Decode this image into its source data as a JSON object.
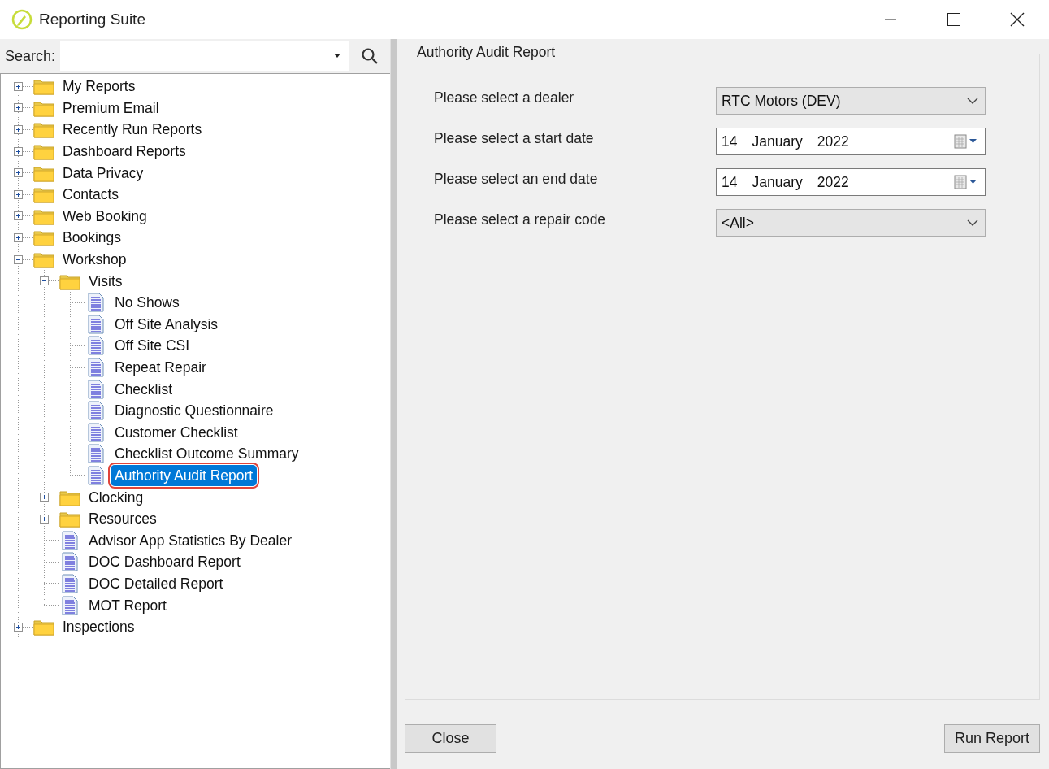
{
  "window": {
    "title": "Reporting Suite"
  },
  "search": {
    "label": "Search:"
  },
  "tree": [
    {
      "label": "My Reports",
      "kind": "folder",
      "expanded": false,
      "selected": false
    },
    {
      "label": "Premium Email",
      "kind": "folder",
      "expanded": false,
      "selected": false
    },
    {
      "label": "Recently Run Reports",
      "kind": "folder",
      "expanded": false,
      "selected": false
    },
    {
      "label": "Dashboard Reports",
      "kind": "folder",
      "expanded": false,
      "selected": false
    },
    {
      "label": "Data Privacy",
      "kind": "folder",
      "expanded": false,
      "selected": false
    },
    {
      "label": "Contacts",
      "kind": "folder",
      "expanded": false,
      "selected": false
    },
    {
      "label": "Web Booking",
      "kind": "folder",
      "expanded": false,
      "selected": false
    },
    {
      "label": "Bookings",
      "kind": "folder",
      "expanded": false,
      "selected": false
    },
    {
      "label": "Workshop",
      "kind": "folder",
      "expanded": true,
      "selected": false,
      "children": [
        {
          "label": "Visits",
          "kind": "folder",
          "expanded": true,
          "selected": false,
          "children": [
            {
              "label": "No Shows",
              "kind": "report",
              "selected": false
            },
            {
              "label": "Off Site Analysis",
              "kind": "report",
              "selected": false
            },
            {
              "label": "Off Site CSI",
              "kind": "report",
              "selected": false
            },
            {
              "label": "Repeat Repair",
              "kind": "report",
              "selected": false
            },
            {
              "label": "Checklist",
              "kind": "report",
              "selected": false
            },
            {
              "label": "Diagnostic Questionnaire",
              "kind": "report",
              "selected": false
            },
            {
              "label": "Customer Checklist",
              "kind": "report",
              "selected": false
            },
            {
              "label": "Checklist Outcome Summary",
              "kind": "report",
              "selected": false
            },
            {
              "label": "Authority Audit Report",
              "kind": "report",
              "selected": true
            }
          ]
        },
        {
          "label": "Clocking",
          "kind": "folder",
          "expanded": false,
          "selected": false
        },
        {
          "label": "Resources",
          "kind": "folder",
          "expanded": false,
          "selected": false
        },
        {
          "label": "Advisor App Statistics By Dealer",
          "kind": "report",
          "selected": false
        },
        {
          "label": "DOC Dashboard Report",
          "kind": "report",
          "selected": false
        },
        {
          "label": "DOC Detailed Report",
          "kind": "report",
          "selected": false
        },
        {
          "label": "MOT Report",
          "kind": "report",
          "selected": false
        }
      ]
    },
    {
      "label": "Inspections",
      "kind": "folder",
      "expanded": false,
      "selected": false
    }
  ],
  "report": {
    "title": "Authority Audit Report",
    "fields": [
      {
        "label": "Please select a dealer",
        "kind": "dropdown",
        "value": "RTC Motors (DEV)"
      },
      {
        "label": "Please select a start date",
        "kind": "date",
        "day": "14",
        "month": "January",
        "year": "2022"
      },
      {
        "label": "Please select an end date",
        "kind": "date",
        "day": "14",
        "month": "January",
        "year": "2022"
      },
      {
        "label": "Please select a repair code",
        "kind": "dropdown",
        "value": "<All>"
      }
    ]
  },
  "buttons": {
    "close": "Close",
    "run": "Run Report"
  }
}
